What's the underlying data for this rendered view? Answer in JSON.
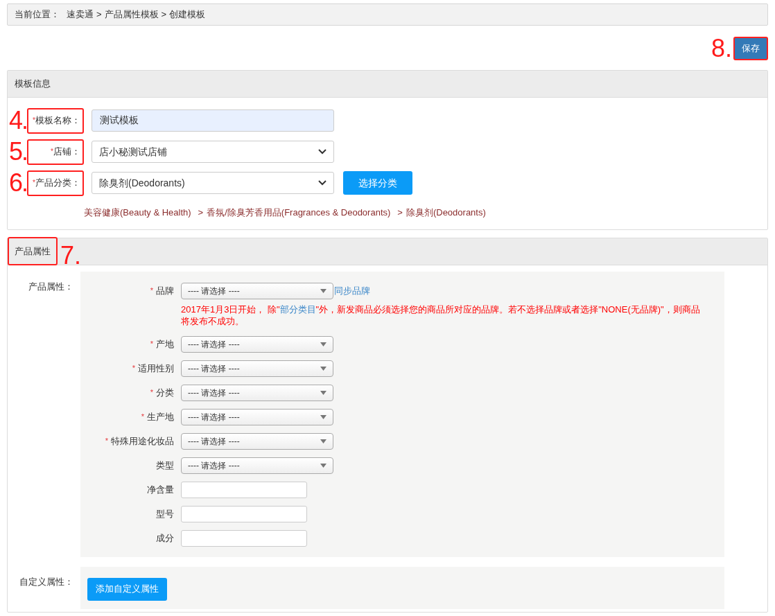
{
  "required_mark": "*",
  "breadcrumb": {
    "label": "当前位置：",
    "items": [
      "速卖通",
      "产品属性模板",
      "创建模板"
    ],
    "separator": ">"
  },
  "save_button": {
    "label": "保存",
    "marker": "8."
  },
  "template_info": {
    "title": "模板信息",
    "fields": [
      {
        "kind": "text",
        "label": "模板名称：",
        "required": true,
        "value": "测试模板",
        "marker": "4.",
        "autofilled": true
      },
      {
        "kind": "select",
        "label": "店铺：",
        "required": true,
        "value": "店小秘测试店铺",
        "marker": "5."
      },
      {
        "kind": "select",
        "label": "产品分类：",
        "required": true,
        "value": "除臭剂(Deodorants)",
        "marker": "6.",
        "button": "选择分类"
      }
    ],
    "category_path": [
      "美容健康(Beauty & Health)",
      "香氛/除臭芳香用品(Fragrances & Deodorants)",
      "除臭剂(Deodorants)"
    ],
    "path_separator": ">"
  },
  "product_attributes": {
    "title": "产品属性",
    "marker": "7.",
    "label": "产品属性：",
    "attributes": [
      {
        "kind": "select",
        "label": "品牌",
        "required": true,
        "value": "---- 请选择 ----",
        "link": "同步品牌",
        "notice": {
          "before": "2017年1月3日开始， 除\"",
          "link": "部分类目",
          "after": "\"外，新发商品必须选择您的商品所对应的品牌。若不选择品牌或者选择\"NONE(无品牌)\"，则商品将发布不成功。"
        }
      },
      {
        "kind": "select",
        "label": "产地",
        "required": true,
        "value": "---- 请选择 ----"
      },
      {
        "kind": "select",
        "label": "适用性别",
        "required": true,
        "value": "---- 请选择 ----"
      },
      {
        "kind": "select",
        "label": "分类",
        "required": true,
        "value": "---- 请选择 ----"
      },
      {
        "kind": "select",
        "label": "生产地",
        "required": true,
        "value": "---- 请选择 ----"
      },
      {
        "kind": "select",
        "label": "特殊用途化妆品",
        "required": true,
        "value": "---- 请选择 ----"
      },
      {
        "kind": "select",
        "label": "类型",
        "required": false,
        "value": "---- 请选择 ----"
      },
      {
        "kind": "text",
        "label": "净含量",
        "required": false
      },
      {
        "kind": "text",
        "label": "型号",
        "required": false
      },
      {
        "kind": "text",
        "label": "成分",
        "required": false
      }
    ],
    "custom_label": "自定义属性：",
    "add_button": "添加自定义属性"
  }
}
